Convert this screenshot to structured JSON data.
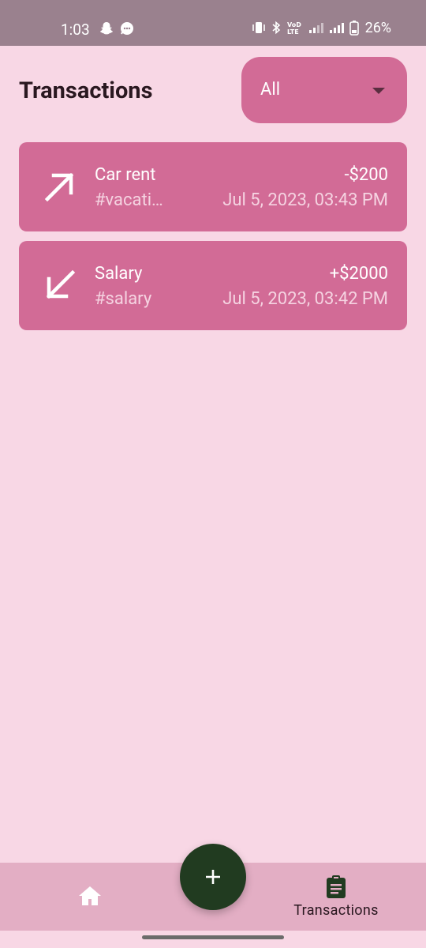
{
  "status_bar": {
    "time": "1:03",
    "battery": "26%",
    "icons": [
      "snapchat-icon",
      "chat-icon",
      "vibrate-icon",
      "bluetooth-icon",
      "volte-icon",
      "signal-icon",
      "signal-icon",
      "battery-icon"
    ]
  },
  "header": {
    "title": "Transactions",
    "filter": {
      "selected": "All"
    }
  },
  "transactions": [
    {
      "title": "Car rent",
      "tag": "#vacati…",
      "amount": "-$200",
      "date": "Jul 5, 2023, 03:43 PM",
      "direction_icon": "arrow-up-right-icon"
    },
    {
      "title": "Salary",
      "tag": "#salary",
      "amount": "+$2000",
      "date": "Jul 5, 2023, 03:42 PM",
      "direction_icon": "arrow-down-left-icon"
    }
  ],
  "bottom_nav": {
    "items": [
      {
        "icon": "home-icon",
        "label": ""
      },
      {
        "icon": "clipboard-icon",
        "label": "Transactions"
      }
    ],
    "fab_icon": "plus-icon"
  },
  "colors": {
    "background": "#f8d7e5",
    "card": "#d26b96",
    "nav": "#e3aec4",
    "fab": "#213b20",
    "status_bar": "#9a818e"
  }
}
